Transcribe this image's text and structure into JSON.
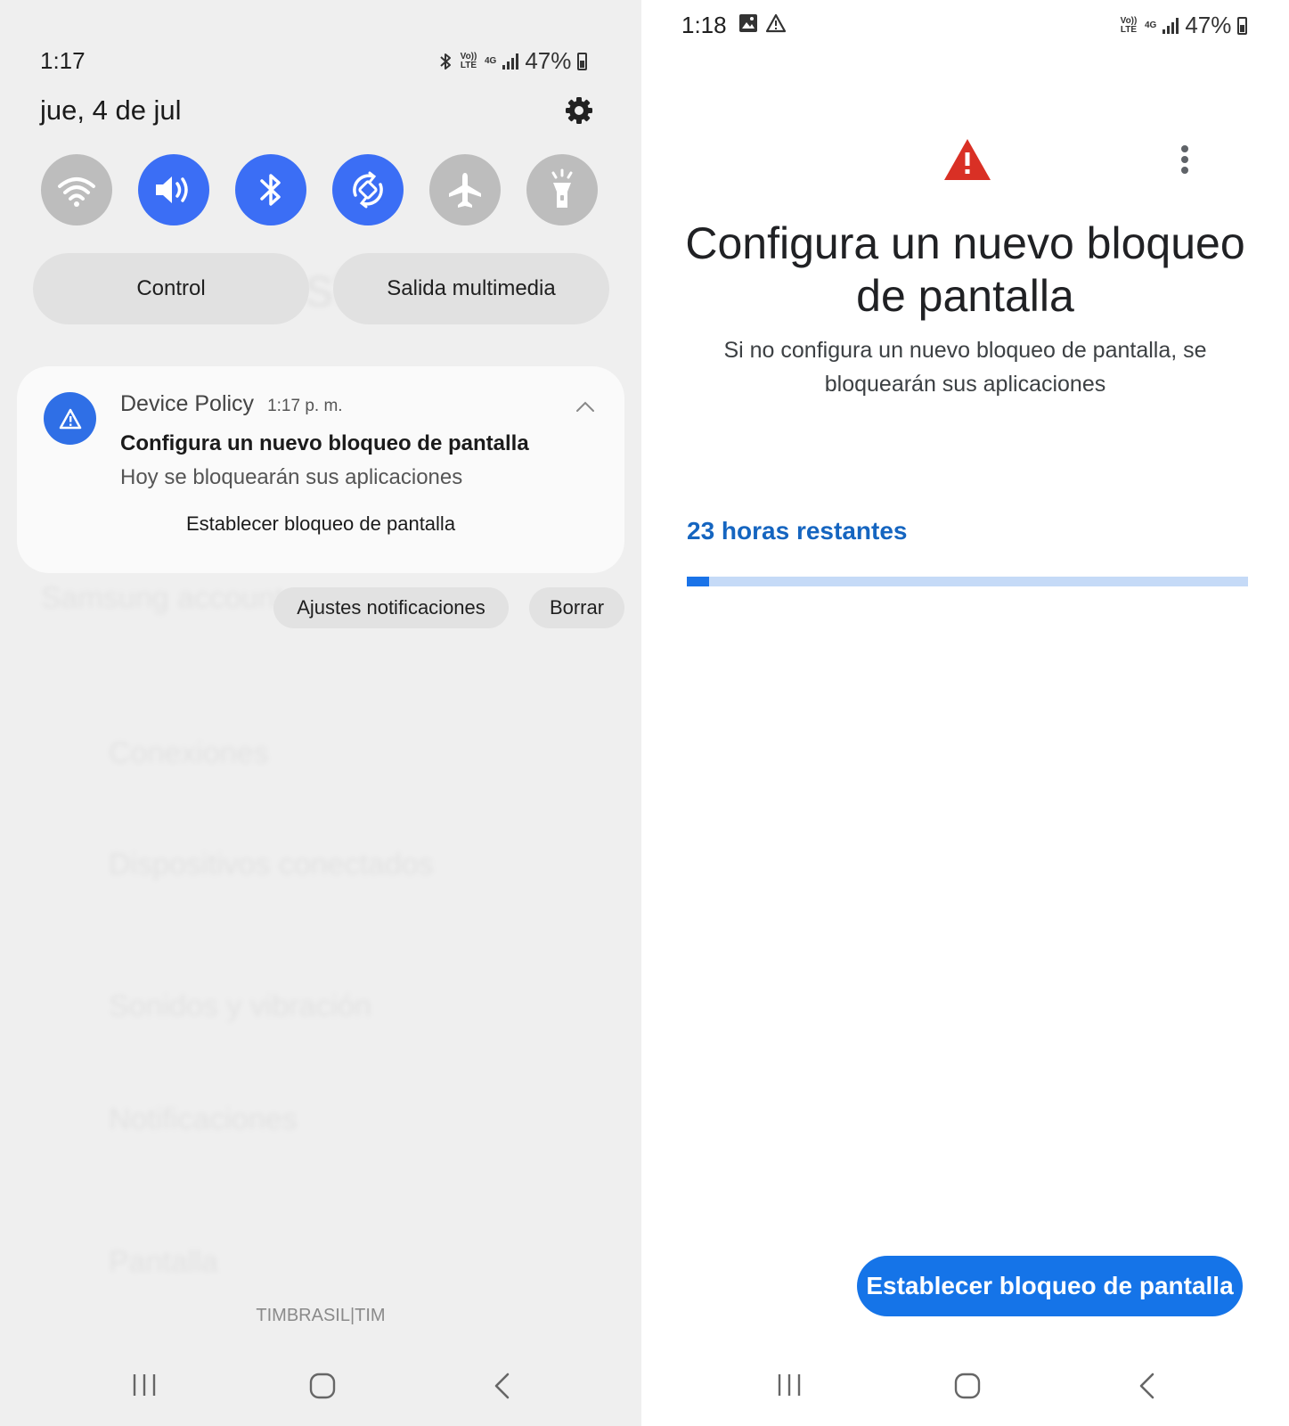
{
  "left_panel": {
    "status_bar": {
      "time": "1:17",
      "battery": "47%",
      "volte": "Vo)) LTE",
      "network": "4G"
    },
    "date": "jue, 4 de jul",
    "quick_tiles": [
      {
        "name": "wifi",
        "state": "off"
      },
      {
        "name": "sound",
        "state": "on"
      },
      {
        "name": "bluetooth",
        "state": "on"
      },
      {
        "name": "auto-rotate",
        "state": "on"
      },
      {
        "name": "airplane-mode",
        "state": "off"
      },
      {
        "name": "flashlight",
        "state": "off"
      }
    ],
    "pills": {
      "control": "Control",
      "media_output": "Salida multimedia"
    },
    "notification": {
      "app": "Device Policy",
      "time": "1:17 p. m.",
      "title": "Configura un nuevo bloqueo de pantalla",
      "body": "Hoy se bloquearán sus aplicaciones",
      "action": "Establecer bloqueo de pantalla"
    },
    "notif_buttons": {
      "settings": "Ajustes notificaciones",
      "clear": "Borrar"
    },
    "background_settings": [
      "Ajustes",
      "Samsung account",
      "Conexiones",
      "Dispositivos conectados",
      "Sonidos y vibración",
      "Notificaciones",
      "Pantalla"
    ],
    "carrier": "TIMBRASIL|TIM"
  },
  "right_panel": {
    "status_bar": {
      "time": "1:18",
      "battery": "47%",
      "volte": "Vo)) LTE",
      "network": "4G"
    },
    "title": "Configura un nuevo bloqueo de pantalla",
    "subtitle": "Si no configura un nuevo bloqueo de pantalla, se bloquearán sus aplicaciones",
    "countdown": "23 horas restantes",
    "progress_fraction": 0.04,
    "button": "Establecer bloqueo de pantalla"
  },
  "colors": {
    "accent_blue": "#3b6ef5",
    "countdown_blue": "#1565c0",
    "warning_red": "#d93025",
    "button_blue": "#1574e8"
  }
}
